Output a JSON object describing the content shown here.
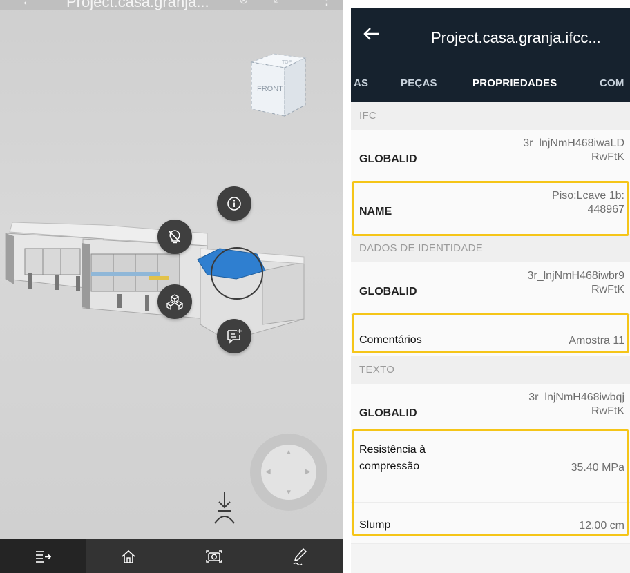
{
  "left_pane": {
    "top_bar": {
      "back_glyph": "←",
      "title": "Project.casa.granja...",
      "icons": [
        "share-icon",
        "fullscreen-icon",
        "more-icon"
      ]
    },
    "view_cube": {
      "face_label": "FRONT",
      "top_label": "TOP"
    },
    "floating_buttons": [
      "info-icon",
      "hide-icon",
      "parts-icon",
      "add-comment-icon"
    ],
    "model_selection_color": "#2f7fd0",
    "bottom_bar": {
      "items": [
        {
          "icon": "properties-icon",
          "active": true
        },
        {
          "icon": "home-icon",
          "active": false
        },
        {
          "icon": "camera-icon",
          "active": false
        },
        {
          "icon": "pencil-icon",
          "active": false
        }
      ]
    }
  },
  "right_pane": {
    "header": {
      "back_glyph": "←",
      "title": "Project.casa.granja.ifcc...",
      "bg_color": "#16222e"
    },
    "tabs": [
      {
        "label": "AS",
        "active": false
      },
      {
        "label": "PEÇAS",
        "active": false
      },
      {
        "label": "PROPRIEDADES",
        "active": true
      },
      {
        "label": "COM",
        "active": false
      }
    ],
    "sections": [
      {
        "title": "IFC",
        "rows": [
          {
            "key": "GLOBALID",
            "value_line1": "3r_lnjNmH468iwaLD",
            "value_line2": "RwFtK"
          },
          {
            "key": "NAME",
            "value_line1": "Piso:Lcave 1b:",
            "value_line2": "448967"
          }
        ]
      },
      {
        "title": "DADOS DE IDENTIDADE",
        "rows": [
          {
            "key": "GLOBALID",
            "value_line1": "3r_lnjNmH468iwbr9",
            "value_line2": "RwFtK"
          },
          {
            "key": "Comentários",
            "value": "Amostra 11"
          }
        ]
      },
      {
        "title": "TEXTO",
        "rows": [
          {
            "key": "GLOBALID",
            "value_line1": "3r_lnjNmH468iwbqj",
            "value_line2": "RwFtK"
          },
          {
            "key_line1": "Resistência à",
            "key_line2": "compressão",
            "value": "35.40 MPa"
          },
          {
            "key": "Slump",
            "value": "12.00 cm"
          }
        ]
      }
    ],
    "highlight_color": "#f5c518"
  }
}
